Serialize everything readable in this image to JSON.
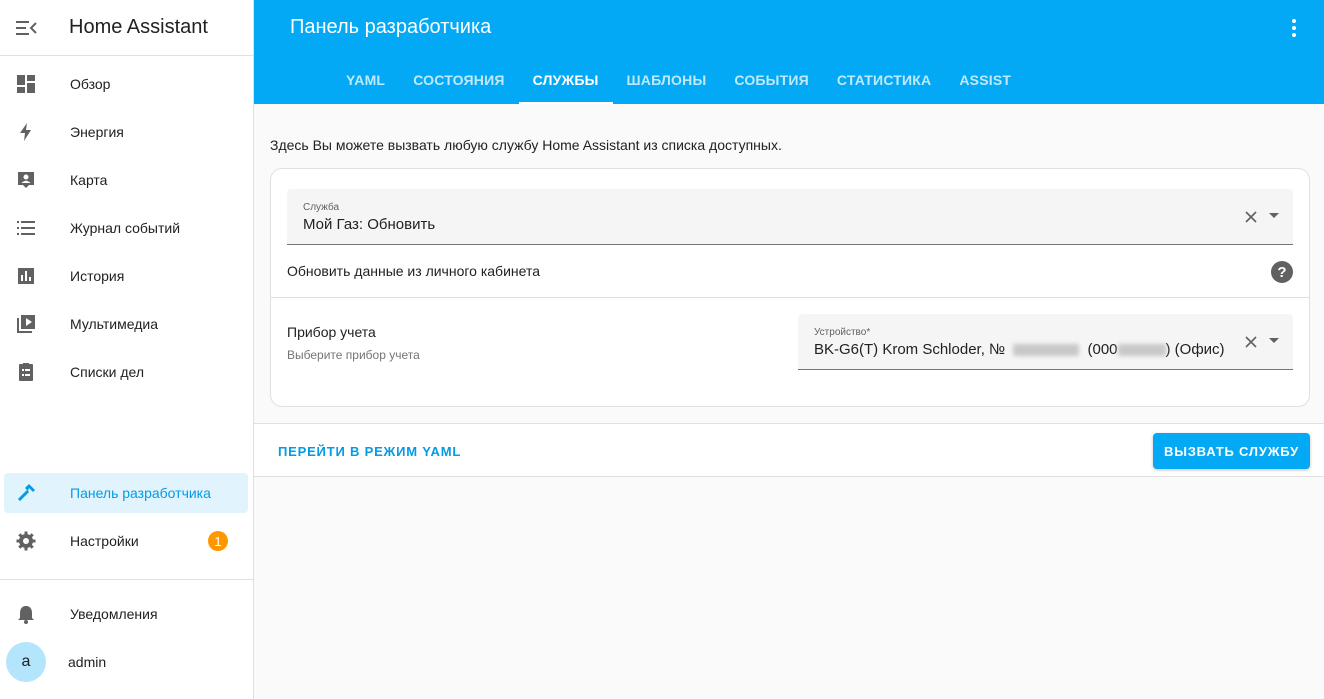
{
  "sidebar": {
    "title": "Home Assistant",
    "items": [
      {
        "label": "Обзор",
        "icon": "dashboard-icon"
      },
      {
        "label": "Энергия",
        "icon": "lightning-icon"
      },
      {
        "label": "Карта",
        "icon": "map-account-icon"
      },
      {
        "label": "Журнал событий",
        "icon": "list-icon"
      },
      {
        "label": "История",
        "icon": "chart-bar-icon"
      },
      {
        "label": "Мультимедиа",
        "icon": "play-box-icon"
      },
      {
        "label": "Списки дел",
        "icon": "clipboard-list-icon"
      }
    ],
    "dev_tools": {
      "label": "Панель разработчика",
      "icon": "hammer-icon"
    },
    "settings": {
      "label": "Настройки",
      "icon": "gear-icon",
      "badge": "1"
    },
    "notifications": {
      "label": "Уведомления",
      "icon": "bell-icon"
    },
    "user": {
      "label": "admin",
      "avatar_letter": "a"
    }
  },
  "header": {
    "title": "Панель разработчика",
    "tabs": [
      "YAML",
      "СОСТОЯНИЯ",
      "СЛУЖБЫ",
      "ШАБЛОНЫ",
      "СОБЫТИЯ",
      "СТАТИСТИКА",
      "ASSIST"
    ],
    "active_tab": "СЛУЖБЫ"
  },
  "main": {
    "description": "Здесь Вы можете вызвать любую службу Home Assistant из списка доступных.",
    "service_field": {
      "label": "Служба",
      "value": "Мой Газ: Обновить"
    },
    "service_description": "Обновить данные из личного кабинета",
    "param": {
      "name": "Прибор учета",
      "description": "Выберите прибор учета"
    },
    "device_field": {
      "label": "Устройство*",
      "value_start": "BK-G6(T) Krom Schloder, №",
      "value_mid": "(000",
      "value_end": ") (Офис)"
    },
    "yaml_button": "ПЕРЕЙТИ В РЕЖИМ YAML",
    "call_button": "ВЫЗВАТЬ СЛУЖБУ"
  },
  "colors": {
    "primary": "#03a9f4",
    "active_text": "#039be5",
    "active_bg": "#e1f3fc",
    "badge": "#ff9800"
  }
}
